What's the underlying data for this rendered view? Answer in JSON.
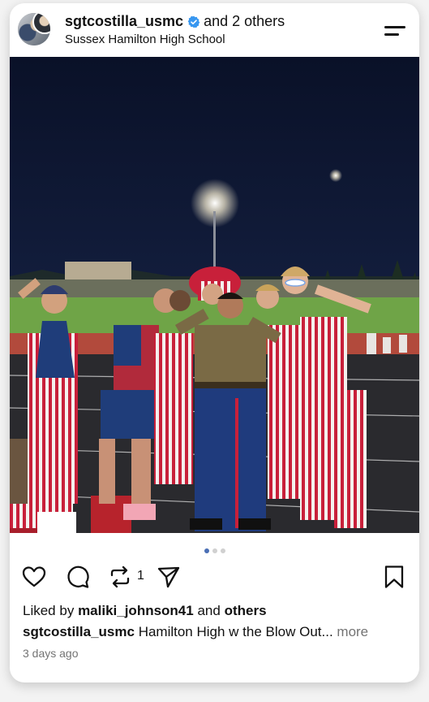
{
  "post": {
    "username": "sgtcostilla_usmc",
    "coauthors": "and 2 others",
    "location": "Sussex Hamilton High School",
    "likes_prefix": "Liked by",
    "liked_by_user": "maliki_johnson41",
    "likes_and": "and",
    "likes_others": "others",
    "caption_user": "sgtcostilla_usmc",
    "caption_text": "Hamilton High w the Blow Out...",
    "more_label": "more",
    "timestamp": "3 days ago",
    "repost_count": "1",
    "carousel": {
      "total": 3,
      "active": 1
    }
  },
  "icons": {
    "verified": "verified-badge-icon",
    "menu": "menu-icon",
    "like": "heart-icon",
    "comment": "comment-icon",
    "repost": "repost-icon",
    "share": "share-send-icon",
    "save": "bookmark-icon"
  },
  "colors": {
    "verified_blue": "#3897f0",
    "active_dot": "#4a6fb5",
    "secondary_text": "#737373"
  }
}
